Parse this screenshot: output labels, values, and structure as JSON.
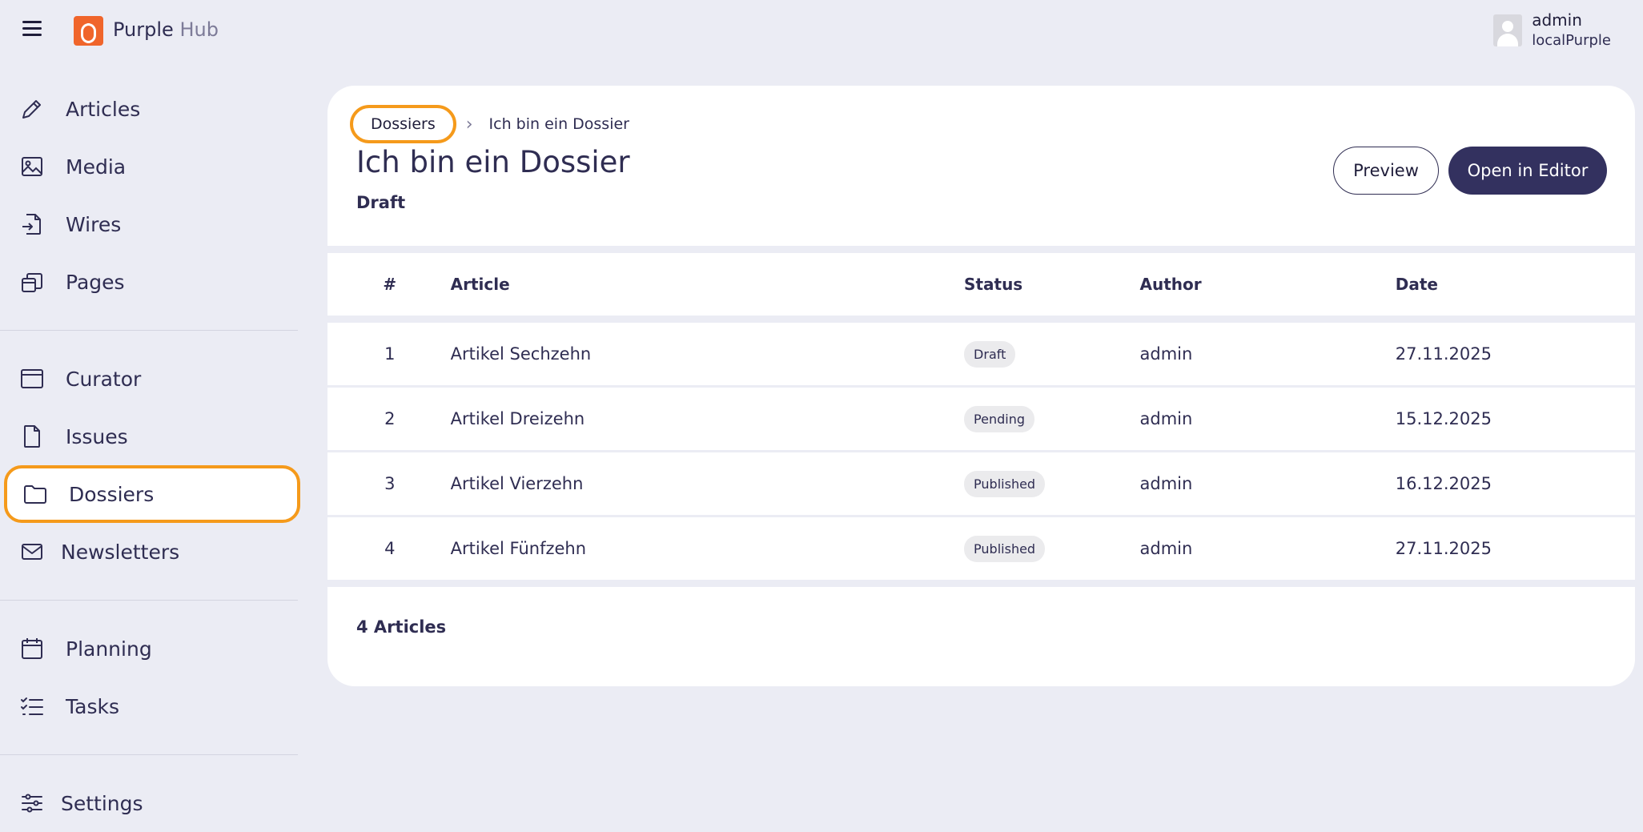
{
  "header": {
    "brand_primary": "Purple",
    "brand_secondary": "Hub",
    "user_name": "admin",
    "user_org": "localPurple"
  },
  "sidebar": {
    "groups": [
      [
        {
          "label": "Articles",
          "icon": "pencil-icon"
        },
        {
          "label": "Media",
          "icon": "image-icon"
        },
        {
          "label": "Wires",
          "icon": "file-import-icon"
        },
        {
          "label": "Pages",
          "icon": "pages-icon"
        }
      ],
      [
        {
          "label": "Curator",
          "icon": "browser-window-icon"
        },
        {
          "label": "Issues",
          "icon": "document-icon"
        },
        {
          "label": "Dossiers",
          "icon": "folder-icon",
          "active": true
        },
        {
          "label": "Newsletters",
          "icon": "envelope-icon"
        }
      ],
      [
        {
          "label": "Planning",
          "icon": "calendar-icon"
        },
        {
          "label": "Tasks",
          "icon": "checklist-icon"
        }
      ],
      [
        {
          "label": "Settings",
          "icon": "sliders-icon"
        }
      ]
    ]
  },
  "breadcrumb": {
    "parent": "Dossiers",
    "current": "Ich bin ein Dossier"
  },
  "dossier": {
    "title": "Ich bin ein Dossier",
    "status": "Draft",
    "preview_label": "Preview",
    "editor_label": "Open in Editor"
  },
  "table": {
    "columns": [
      "#",
      "Article",
      "Status",
      "Author",
      "Date"
    ],
    "rows": [
      {
        "n": "1",
        "article": "Artikel Sechzehn",
        "status": "Draft",
        "author": "admin",
        "date": "27.11.2025"
      },
      {
        "n": "2",
        "article": "Artikel Dreizehn",
        "status": "Pending",
        "author": "admin",
        "date": "15.12.2025"
      },
      {
        "n": "3",
        "article": "Artikel Vierzehn",
        "status": "Published",
        "author": "admin",
        "date": "16.12.2025"
      },
      {
        "n": "4",
        "article": "Artikel Fünfzehn",
        "status": "Published",
        "author": "admin",
        "date": "27.11.2025"
      }
    ],
    "footer": "4 Articles"
  },
  "colors": {
    "accent": "#33315f",
    "highlight": "#f59a1b",
    "logo": "#f0652b",
    "background": "#ebecf4"
  }
}
